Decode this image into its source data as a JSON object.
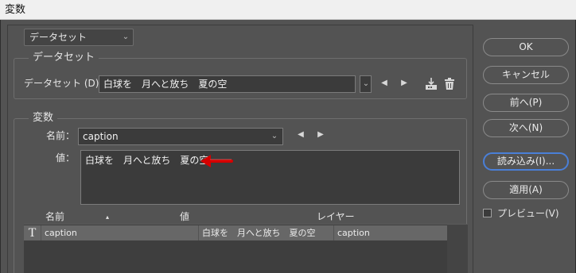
{
  "window": {
    "title": "変数"
  },
  "preset_select": {
    "value": "データセット"
  },
  "dataset_group": {
    "title": "データセット",
    "label": "データセット (D)：",
    "value": "白球を　月へと放ち　夏の空"
  },
  "variable_group": {
    "title": "変数",
    "name_label": "名前：",
    "name_value": "caption",
    "value_label": "値：",
    "value_text": "白球を　月へと放ち　夏の空"
  },
  "table": {
    "headers": {
      "name": "名前",
      "sort": "▴",
      "value": "値",
      "layer": "レイヤー"
    },
    "rows": [
      {
        "icon": "T",
        "name": "caption",
        "value": "白球を　月へと放ち　夏の空",
        "layer": "caption"
      }
    ]
  },
  "buttons": {
    "ok": "OK",
    "cancel": "キャンセル",
    "prev": "前へ(P)",
    "next": "次へ(N)",
    "import": "読み込み(I)...",
    "apply": "適用(A)"
  },
  "preview": {
    "label": "プレビュー(V)",
    "checked": false
  },
  "colors": {
    "panel": "#535353",
    "input": "#3b3b3b",
    "selected_row": "#676767",
    "focus_ring": "#4a7fd7",
    "annotation_arrow": "#d40000"
  }
}
